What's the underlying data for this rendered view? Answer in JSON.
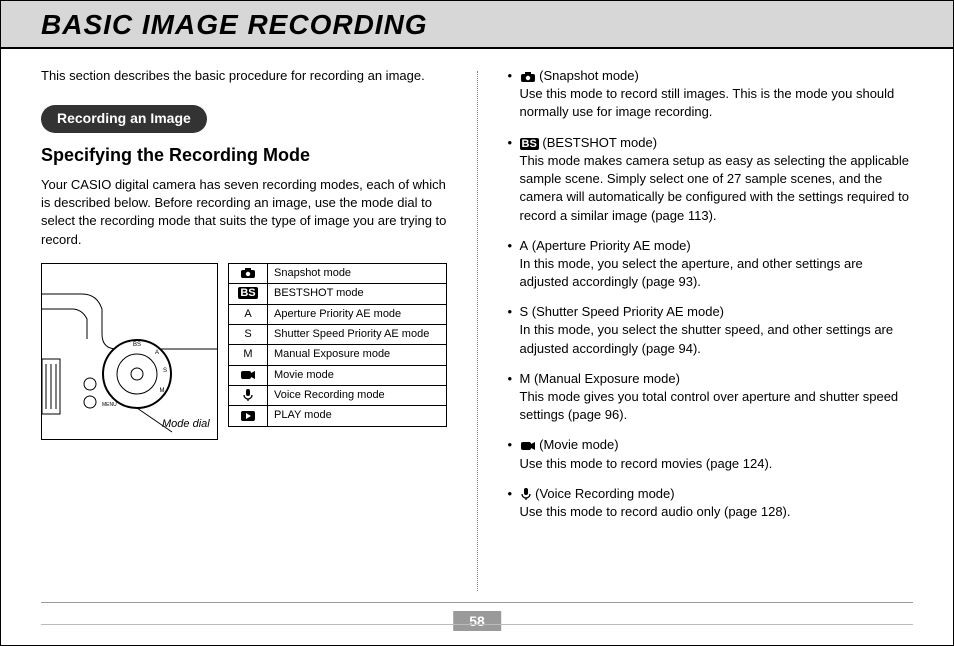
{
  "header": {
    "title": "BASIC IMAGE RECORDING"
  },
  "left": {
    "intro": "This section describes the basic procedure for recording an image.",
    "pill": "Recording an Image",
    "h2": "Specifying the Recording Mode",
    "sub": "Your CASIO digital camera has seven recording modes, each of which is described below. Before recording an image, use the mode dial to select the recording mode that suits the type of image you are trying to record.",
    "caption": "Mode dial",
    "table": [
      {
        "icon": "camera",
        "label": "Snapshot mode"
      },
      {
        "icon": "bs",
        "label": "BESTSHOT mode"
      },
      {
        "icon": "A",
        "label": "Aperture Priority AE mode"
      },
      {
        "icon": "S",
        "label": "Shutter Speed Priority AE mode"
      },
      {
        "icon": "M",
        "label": "Manual Exposure mode"
      },
      {
        "icon": "movie",
        "label": "Movie mode"
      },
      {
        "icon": "mic",
        "label": "Voice Recording mode"
      },
      {
        "icon": "play",
        "label": "PLAY mode"
      }
    ]
  },
  "right": {
    "items": [
      {
        "icon": "camera",
        "name": "(Snapshot mode)",
        "desc": "Use this mode to record still images. This is the mode you should normally use for image recording."
      },
      {
        "icon": "bs",
        "name": "(BESTSHOT mode)",
        "desc": "This mode makes camera setup as easy as selecting the applicable sample scene. Simply select one of 27 sample scenes, and the camera will automatically be configured with the settings required to record a similar image (page 113)."
      },
      {
        "icon": "A",
        "name": "(Aperture Priority AE mode)",
        "desc": "In this mode, you select the aperture, and other settings are adjusted accordingly (page 93)."
      },
      {
        "icon": "S",
        "name": "(Shutter Speed Priority AE mode)",
        "desc": "In this mode, you select the shutter speed, and other settings are adjusted accordingly (page 94)."
      },
      {
        "icon": "M",
        "name": "(Manual Exposure mode)",
        "desc": "This mode gives you total control over aperture and shutter speed settings (page 96)."
      },
      {
        "icon": "movie",
        "name": "(Movie mode)",
        "desc": "Use this mode to record movies (page 124)."
      },
      {
        "icon": "mic",
        "name": "(Voice Recording mode)",
        "desc": "Use this mode to record audio only (page 128)."
      }
    ]
  },
  "pagenum": "58"
}
